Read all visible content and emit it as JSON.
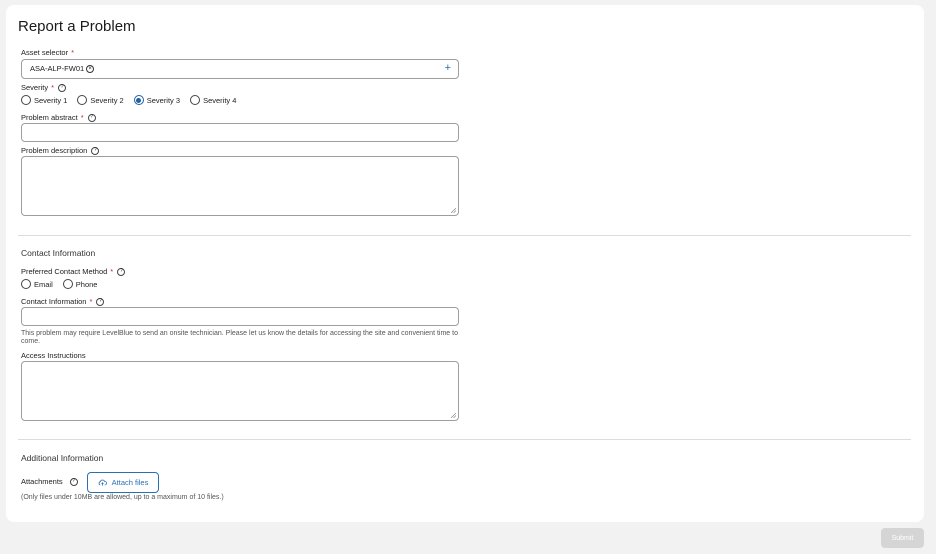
{
  "title": "Report a Problem",
  "asset": {
    "label": "Asset selector",
    "required_mark": "*",
    "chip": "ASA-ALP-FW01",
    "chip_remove": "⊗",
    "add": "+"
  },
  "severity": {
    "label": "Severity",
    "required_mark": "*",
    "options": [
      "Severity 1",
      "Severity 2",
      "Severity 3",
      "Severity 4"
    ],
    "selected": "Severity 3"
  },
  "abstract": {
    "label": "Problem abstract",
    "required_mark": "*",
    "value": ""
  },
  "description": {
    "label": "Problem description",
    "value": ""
  },
  "contact": {
    "heading": "Contact Information",
    "method_label": "Preferred Contact Method",
    "required_mark": "*",
    "methods": [
      "Email",
      "Phone"
    ],
    "info_label": "Contact Information",
    "info_value": "",
    "onsite_note": "This problem may require LevelBlue to send an onsite technician. Please let us know the details for accessing the site and convenient time to come.",
    "access_label": "Access Instructions",
    "access_value": ""
  },
  "additional": {
    "heading": "Additional Information",
    "attachments_label": "Attachments",
    "attach_button": "Attach files",
    "attach_note": "(Only files under 10MB are allowed, up to a maximum of 10 files.)"
  },
  "help_glyph": "?",
  "submit_label": "Submit",
  "colors": {
    "accent": "#2a6fb0",
    "required": "#c62828",
    "radio_selected": "#1f5fa8"
  }
}
